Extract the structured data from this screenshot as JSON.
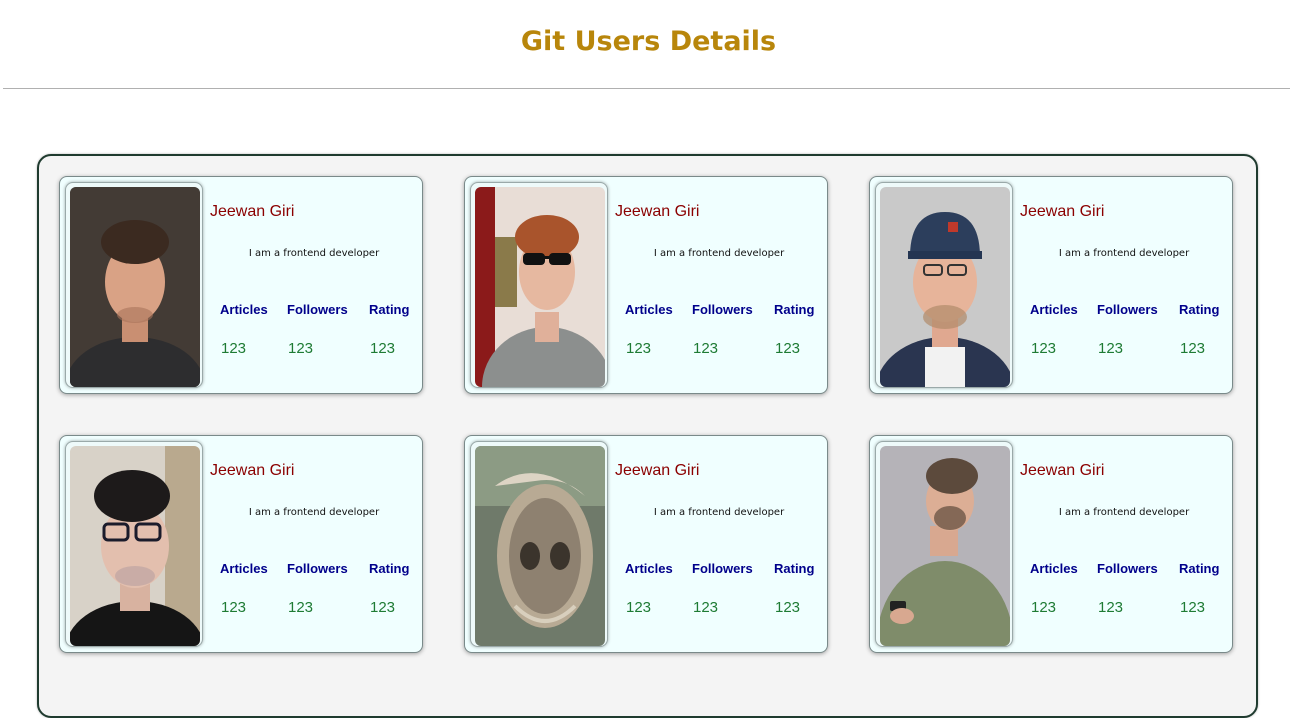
{
  "header": {
    "title": "Git Users Details"
  },
  "colors": {
    "title": "#b8860b",
    "name": "#8b0000",
    "stat_label": "#00008b",
    "stat_value": "#1e7b34",
    "card_bg": "#f0ffff",
    "container_border": "#1f3b2f"
  },
  "users": [
    {
      "name": "Jeewan Giri",
      "bio": "I am a frontend developer",
      "stats": {
        "articles_label": "Articles",
        "followers_label": "Followers",
        "rating_label": "Rating",
        "articles": "123",
        "followers": "123",
        "rating": "123"
      }
    },
    {
      "name": "Jeewan Giri",
      "bio": "I am a frontend developer",
      "stats": {
        "articles_label": "Articles",
        "followers_label": "Followers",
        "rating_label": "Rating",
        "articles": "123",
        "followers": "123",
        "rating": "123"
      }
    },
    {
      "name": "Jeewan Giri",
      "bio": "I am a frontend developer",
      "stats": {
        "articles_label": "Articles",
        "followers_label": "Followers",
        "rating_label": "Rating",
        "articles": "123",
        "followers": "123",
        "rating": "123"
      }
    },
    {
      "name": "Jeewan Giri",
      "bio": "I am a frontend developer",
      "stats": {
        "articles_label": "Articles",
        "followers_label": "Followers",
        "rating_label": "Rating",
        "articles": "123",
        "followers": "123",
        "rating": "123"
      }
    },
    {
      "name": "Jeewan Giri",
      "bio": "I am a frontend developer",
      "stats": {
        "articles_label": "Articles",
        "followers_label": "Followers",
        "rating_label": "Rating",
        "articles": "123",
        "followers": "123",
        "rating": "123"
      }
    },
    {
      "name": "Jeewan Giri",
      "bio": "I am a frontend developer",
      "stats": {
        "articles_label": "Articles",
        "followers_label": "Followers",
        "rating_label": "Rating",
        "articles": "123",
        "followers": "123",
        "rating": "123"
      }
    }
  ]
}
